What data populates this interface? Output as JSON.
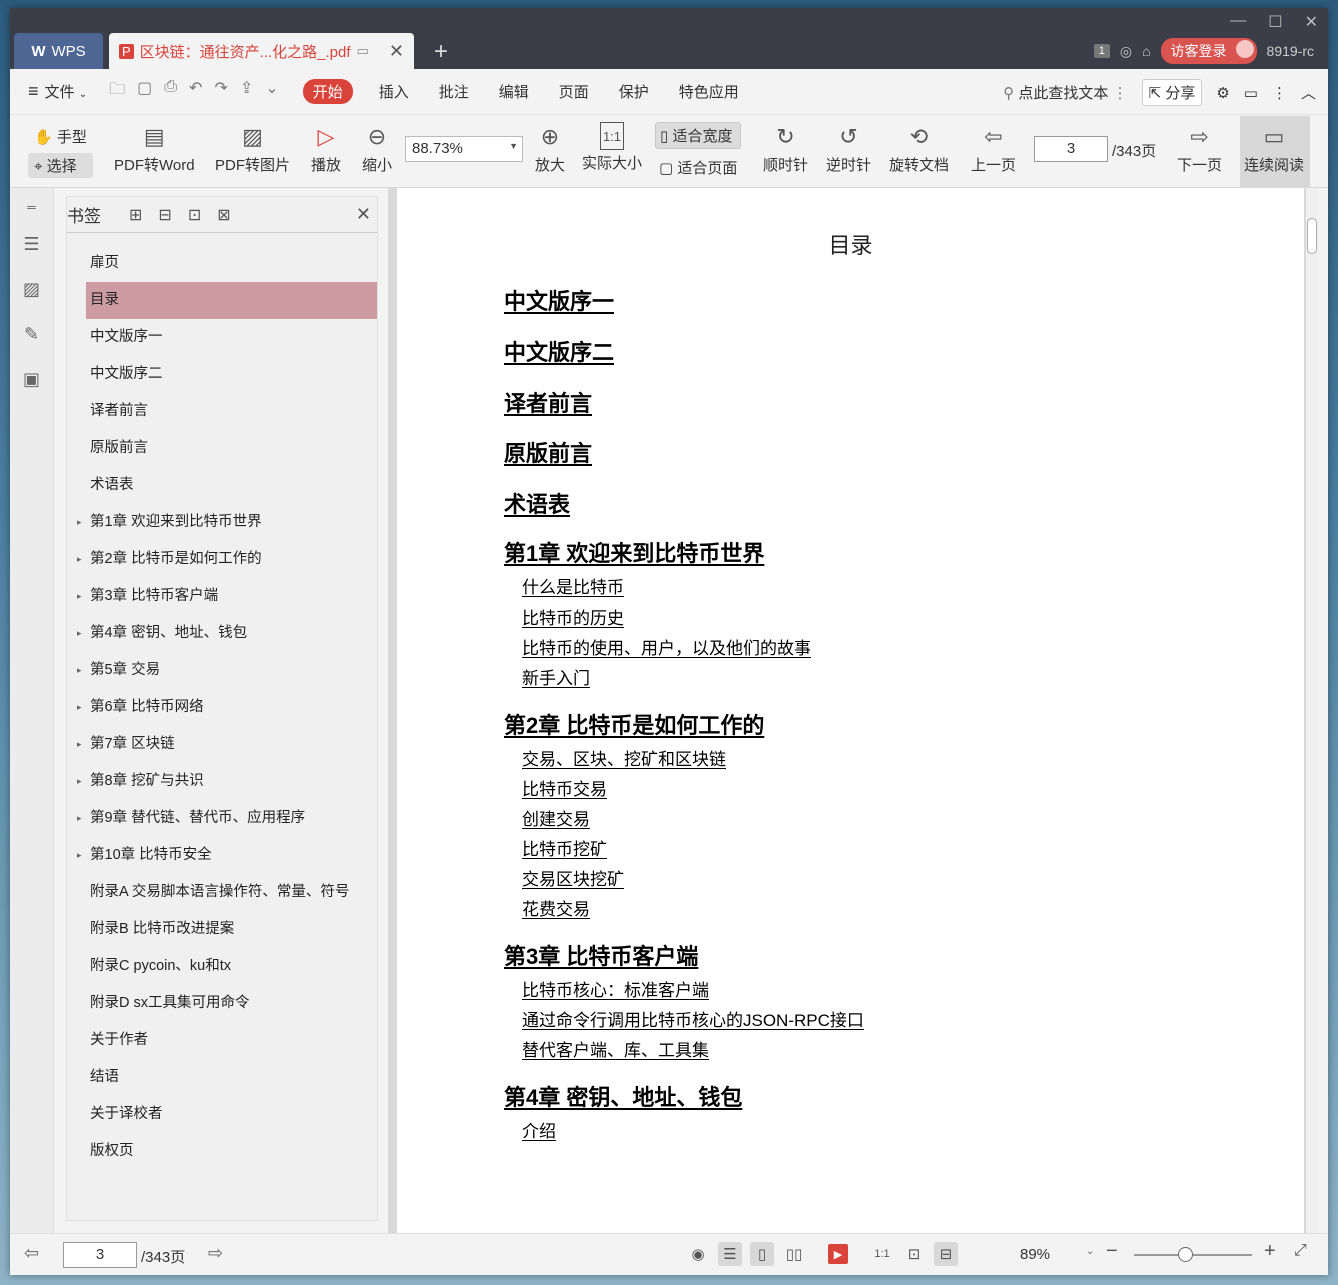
{
  "titlebar": {
    "wps_tab": "WPS",
    "doc_tab": "区块链：通往资产...化之路_.pdf",
    "badge": "1",
    "login": "访客登录",
    "user": "8919-rc"
  },
  "menu": {
    "file": "文件",
    "start": "开始",
    "insert": "插入",
    "comment": "批注",
    "edit": "编辑",
    "page": "页面",
    "protect": "保护",
    "special": "特色应用",
    "search": "点此查找文本",
    "share": "分享"
  },
  "toolbar": {
    "hand": "手型",
    "select": "选择",
    "pdf2word": "PDF转Word",
    "pdf2img": "PDF转图片",
    "play": "播放",
    "zoom_out": "缩小",
    "zoom_value": "88.73%",
    "zoom_in": "放大",
    "actual": "实际大小",
    "fit_width": "适合宽度",
    "fit_page": "适合页面",
    "cw": "顺时针",
    "ccw": "逆时针",
    "rotate": "旋转文档",
    "prev": "上一页",
    "page_num": "3",
    "page_total": "/343页",
    "next": "下一页",
    "continuous": "连续阅读"
  },
  "bookmarks": {
    "title": "书签",
    "items": [
      {
        "label": "扉页",
        "expand": false
      },
      {
        "label": "目录",
        "expand": false,
        "selected": true
      },
      {
        "label": "中文版序一",
        "expand": false
      },
      {
        "label": "中文版序二",
        "expand": false
      },
      {
        "label": "译者前言",
        "expand": false
      },
      {
        "label": "原版前言",
        "expand": false
      },
      {
        "label": "术语表",
        "expand": false
      },
      {
        "label": "第1章 欢迎来到比特币世界",
        "expand": true
      },
      {
        "label": "第2章 比特币是如何工作的",
        "expand": true
      },
      {
        "label": "第3章 比特币客户端",
        "expand": true
      },
      {
        "label": "第4章 密钥、地址、钱包",
        "expand": true
      },
      {
        "label": "第5章 交易",
        "expand": true
      },
      {
        "label": "第6章 比特币网络",
        "expand": true
      },
      {
        "label": "第7章 区块链",
        "expand": true
      },
      {
        "label": "第8章 挖矿与共识",
        "expand": true
      },
      {
        "label": "第9章 替代链、替代币、应用程序",
        "expand": true
      },
      {
        "label": "第10章 比特币安全",
        "expand": true
      },
      {
        "label": "附录A 交易脚本语言操作符、常量、符号",
        "expand": false
      },
      {
        "label": "附录B 比特币改进提案",
        "expand": false
      },
      {
        "label": "附录C pycoin、ku和tx",
        "expand": false
      },
      {
        "label": "附录D sx工具集可用命令",
        "expand": false
      },
      {
        "label": "关于作者",
        "expand": false
      },
      {
        "label": "结语",
        "expand": false
      },
      {
        "label": "关于译校者",
        "expand": false
      },
      {
        "label": "版权页",
        "expand": false
      }
    ]
  },
  "doc": {
    "title": "目录",
    "h1": "中文版序一",
    "h2": "中文版序二",
    "h3": "译者前言",
    "h4": "原版前言",
    "h5": "术语表",
    "ch1": "第1章 欢迎来到比特币世界",
    "ch1_s1": "什么是比特币",
    "ch1_s2": "比特币的历史",
    "ch1_s3": "比特币的使用、用户，以及他们的故事",
    "ch1_s4": "新手入门",
    "ch2": "第2章 比特币是如何工作的",
    "ch2_s1": "交易、区块、挖矿和区块链",
    "ch2_s2": "比特币交易",
    "ch2_s3": "创建交易",
    "ch2_s4": "比特币挖矿",
    "ch2_s5": "交易区块挖矿",
    "ch2_s6": "花费交易",
    "ch3": "第3章 比特币客户端",
    "ch3_s1": "比特币核心：标准客户端",
    "ch3_s2": "通过命令行调用比特币核心的JSON-RPC接口",
    "ch3_s3": "替代客户端、库、工具集",
    "ch4": "第4章 密钥、地址、钱包",
    "ch4_s1": "介绍"
  },
  "status": {
    "page": "3",
    "total": "/343页",
    "zoom": "89%"
  }
}
